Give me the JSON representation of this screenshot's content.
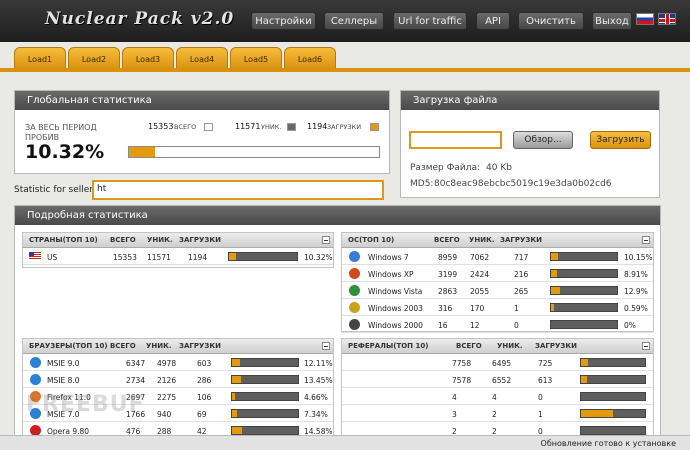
{
  "app": {
    "logo": "Nuclear Pack v2.0"
  },
  "nav": [
    "Настройки",
    "Селлеры",
    "Url for traffic",
    "API",
    "Очистить",
    "Выход"
  ],
  "load_tabs": [
    "Load1",
    "Load2",
    "Load3",
    "Load4",
    "Load5",
    "Load6"
  ],
  "global_stats": {
    "title": "Глобальная статистика",
    "period_label": "ЗА ВЕСЬ ПЕРИОД",
    "total": "15353",
    "total_label": "ВСЕГО",
    "unique": "11571",
    "unique_label": "УНИК.",
    "loads": "1194",
    "loads_label": "ЗАГРУЗКИ",
    "hit_label": "ПРОБИВ",
    "hit_percent": "10.32%",
    "hit_fraction": 0.1032
  },
  "upload": {
    "title": "Загрузка файла",
    "browse_label": "Обзор...",
    "upload_label": "Загрузить",
    "size_label": "Размер Файла:",
    "size_value": "40 Kb",
    "md5_label": "MD5:",
    "md5_value": "80c8eac98ebcbc5019c19e3da0b02cd6"
  },
  "seller": {
    "label": "Statistic for seller:",
    "value": "ht"
  },
  "detailed": {
    "title": "Подробная статистика"
  },
  "countries": {
    "headers": [
      "СТРАНЫ(ТОП 10)",
      "ВСЕГО",
      "УНИК.",
      "ЗАГРУЗКИ"
    ],
    "rows": [
      {
        "name": "US",
        "total": "15353",
        "unique": "11571",
        "loads": "1194",
        "pct": "10.32%",
        "frac": 0.1032,
        "icon": "us-flag-icon"
      }
    ]
  },
  "os": {
    "headers": [
      "ОС(ТОП 10)",
      "ВСЕГО",
      "УНИК.",
      "ЗАГРУЗКИ"
    ],
    "rows": [
      {
        "name": "Windows 7",
        "total": "8959",
        "unique": "7062",
        "loads": "717",
        "pct": "10.15%",
        "frac": 0.1015,
        "icon": "windows-icon",
        "color": "#3a7bd5"
      },
      {
        "name": "Windows XP",
        "total": "3199",
        "unique": "2424",
        "loads": "216",
        "pct": "8.91%",
        "frac": 0.0891,
        "icon": "windows-icon",
        "color": "#d34a1c"
      },
      {
        "name": "Windows Vista",
        "total": "2863",
        "unique": "2055",
        "loads": "265",
        "pct": "12.9%",
        "frac": 0.129,
        "icon": "windows-icon",
        "color": "#2f8f3a"
      },
      {
        "name": "Windows 2003",
        "total": "316",
        "unique": "170",
        "loads": "1",
        "pct": "0.59%",
        "frac": 0.0059,
        "icon": "windows-icon",
        "color": "#c8a21a"
      },
      {
        "name": "Windows 2000",
        "total": "16",
        "unique": "12",
        "loads": "0",
        "pct": "0%",
        "frac": 0,
        "icon": "windows-icon",
        "color": "#444"
      }
    ]
  },
  "browsers": {
    "headers": [
      "БРАУЗЕРЫ(ТОП 10)",
      "ВСЕГО",
      "УНИК.",
      "ЗАГРУЗКИ"
    ],
    "rows": [
      {
        "name": "MSIE 9.0",
        "total": "6347",
        "unique": "4978",
        "loads": "603",
        "pct": "12.11%",
        "frac": 0.1211,
        "icon": "ie-icon",
        "color": "#2b7fd6"
      },
      {
        "name": "MSIE 8.0",
        "total": "2734",
        "unique": "2126",
        "loads": "286",
        "pct": "13.45%",
        "frac": 0.1345,
        "icon": "ie-icon",
        "color": "#2b7fd6"
      },
      {
        "name": "Firefox 11.0",
        "total": "2697",
        "unique": "2275",
        "loads": "106",
        "pct": "4.66%",
        "frac": 0.0466,
        "icon": "firefox-icon",
        "color": "#e2701b"
      },
      {
        "name": "MSIE 7.0",
        "total": "1766",
        "unique": "940",
        "loads": "69",
        "pct": "7.34%",
        "frac": 0.0734,
        "icon": "ie-icon",
        "color": "#2b7fd6"
      },
      {
        "name": "Opera 9.80",
        "total": "476",
        "unique": "288",
        "loads": "42",
        "pct": "14.58%",
        "frac": 0.1458,
        "icon": "opera-icon",
        "color": "#cc1f1f"
      }
    ]
  },
  "referrers": {
    "headers": [
      "РЕФЕРАЛЫ(ТОП 10)",
      "ВСЕГО",
      "УНИК.",
      "ЗАГРУЗКИ"
    ],
    "rows": [
      {
        "total": "7758",
        "unique": "6495",
        "loads": "725",
        "pct": "11.1%",
        "frac": 0.111
      },
      {
        "total": "7578",
        "unique": "6552",
        "loads": "613",
        "pct": "9.3%",
        "frac": 0.093
      },
      {
        "total": "4",
        "unique": "4",
        "loads": "0",
        "pct": "0%",
        "frac": 0
      },
      {
        "total": "3",
        "unique": "2",
        "loads": "1",
        "pct": "50%",
        "frac": 0.5
      },
      {
        "total": "2",
        "unique": "2",
        "loads": "0",
        "pct": "0%",
        "frac": 0
      }
    ]
  },
  "watermark": "FREEBUF",
  "status": "Обновление готово к установке"
}
